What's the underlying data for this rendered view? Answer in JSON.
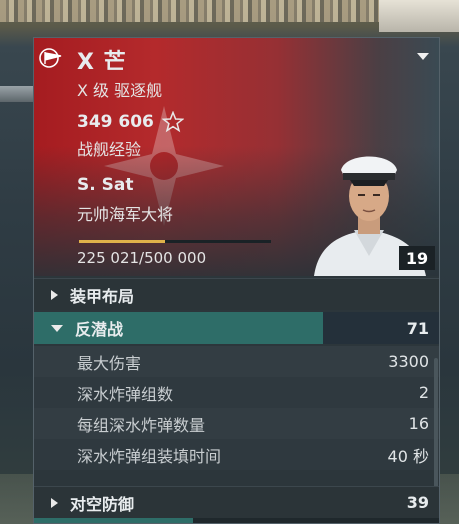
{
  "ship": {
    "name": "X 芒",
    "type": "X 级 驱逐舰",
    "xp_value": "349 606",
    "xp_label": "战舰经验"
  },
  "commander": {
    "name": "S. Sat",
    "rank": "元帅海军大将",
    "level": "19",
    "progress_text": "225 021/500 000",
    "progress_fraction": 0.45
  },
  "sections": {
    "armor": {
      "label": "装甲布局"
    },
    "asw": {
      "label": "反潜战",
      "value": "71",
      "fraction": 0.71
    },
    "aa": {
      "label": "对空防御",
      "value": "39",
      "fraction": 0.39
    }
  },
  "asw_stats": [
    {
      "label": "最大伤害",
      "value": "3300"
    },
    {
      "label": "深水炸弹组数",
      "value": "2"
    },
    {
      "label": "每组深水炸弹数量",
      "value": "16"
    },
    {
      "label": "深水炸弹组装填时间",
      "value": "40 秒"
    }
  ],
  "colors": {
    "flag_red": "#a51c20",
    "accent_teal": "#2e6d68",
    "progress_gold": "#e0b24a"
  },
  "icons": [
    "flag-icon",
    "chevron-down-icon",
    "star-icon",
    "chevron-right-icon"
  ]
}
